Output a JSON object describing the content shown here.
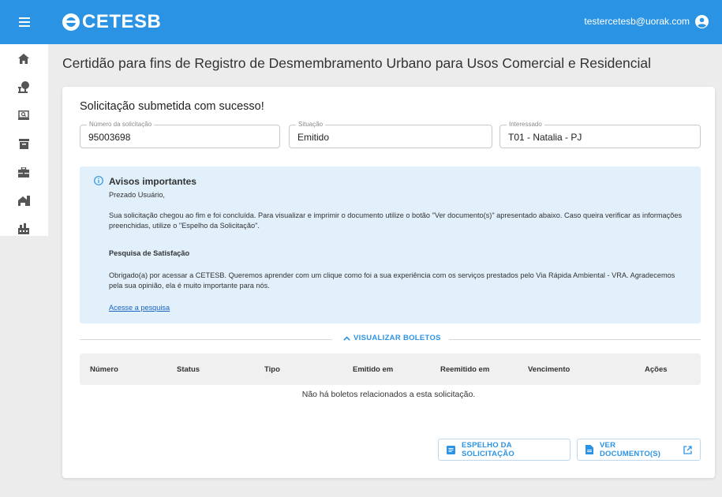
{
  "header": {
    "brand": "CETESB",
    "user_email": "testercetesb@uorak.com",
    "menu_icon": "hamburger-icon",
    "user_icon": "account-circle-icon"
  },
  "sidebar": {
    "items": [
      {
        "icon": "home-icon"
      },
      {
        "icon": "tree-icon"
      },
      {
        "icon": "monitor-search-icon"
      },
      {
        "icon": "archive-icon"
      },
      {
        "icon": "briefcase-icon"
      },
      {
        "icon": "house-icon"
      },
      {
        "icon": "factory-icon"
      }
    ]
  },
  "page": {
    "title": "Certidão para fins de Registro de Desmembramento Urbano para Usos Comercial e Residencial"
  },
  "card": {
    "success_title": "Solicitação submetida com sucesso!",
    "fields": [
      {
        "label": "Número da solicitação",
        "value": "95003698"
      },
      {
        "label": "Situação",
        "value": "Emitido"
      },
      {
        "label": "Interessado",
        "value": "T01 - Natalia - PJ"
      }
    ],
    "notice": {
      "title": "Avisos importantes",
      "greeting": "Prezado Usuário,",
      "body": "Sua solicitação chegou ao fim e foi concluída. Para visualizar e imprimir o documento utilize o botão \"Ver documento(s)\" apresentado abaixo. Caso queira verificar as informações preenchidas, utilize o \"Espelho da Solicitação\".",
      "survey_title": "Pesquisa de Satisfação",
      "survey_body": "Obrigado(a) por acessar a CETESB. Queremos aprender com um clique como foi a sua experiência com os serviços prestados pelo Via Rápida Ambiental - VRA. Agradecemos pela sua opinião, ela é muito importante para nós.",
      "survey_link": "Acesse a pesquisa"
    },
    "boletos_toggle": "VISUALIZAR BOLETOS",
    "table": {
      "columns": [
        "Número",
        "Status",
        "Tipo",
        "Emitido em",
        "Reemitido em",
        "Vencimento",
        "Ações"
      ],
      "empty_message": "Não há boletos relacionados a esta solicitação."
    },
    "buttons": {
      "espelho": "ESPELHO DA SOLICITAÇÃO",
      "ver_documento": "VER DOCUMENTO(S)"
    }
  },
  "colors": {
    "primary": "#2b93e3",
    "notice_bg": "#e1f0fb",
    "link": "#1a62c4"
  }
}
